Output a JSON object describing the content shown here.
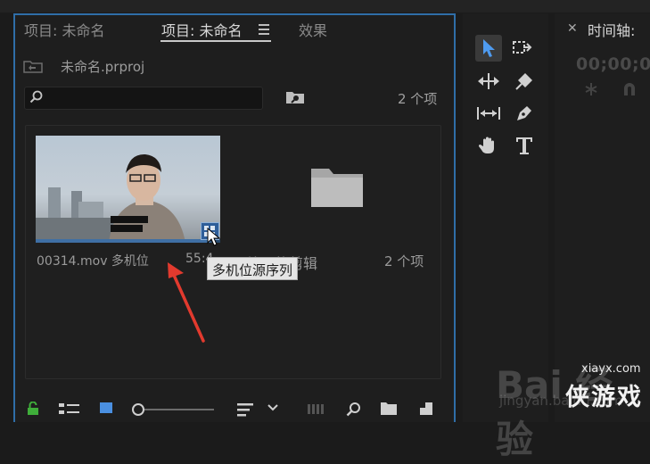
{
  "project_panel": {
    "tabs": [
      {
        "label": "项目: 未命名",
        "active": false
      },
      {
        "label": "项目: 未命名",
        "active": true
      },
      {
        "label": "效果",
        "active": false
      }
    ],
    "project_file": "未命名.prproj",
    "search": {
      "placeholder": "",
      "value": ""
    },
    "item_count": "2 个项",
    "items": [
      {
        "type": "multicam-clip",
        "name": "00314.mov 多机位",
        "duration": "55:4"
      },
      {
        "type": "bin",
        "name": "处理的剪辑",
        "count": "2 个项"
      }
    ],
    "tooltip": "多机位源序列",
    "accent_color": "#2f6ea8",
    "bottom_toolbar_icons": [
      "lock-icon",
      "list-view-icon",
      "icon-view-icon",
      "zoom-slider",
      "sort-icon",
      "chevron-down-icon",
      "automate-to-sequence-icon",
      "find-icon",
      "new-bin-icon",
      "new-item-icon"
    ]
  },
  "tools": [
    "selection-tool",
    "track-select-forward-tool",
    "ripple-edit-tool",
    "razor-tool",
    "slip-tool",
    "pen-tool",
    "hand-tool",
    "type-tool"
  ],
  "timeline": {
    "title": "时间轴:",
    "timecode": "00;00;00"
  },
  "watermark": {
    "url": "xiayx.com",
    "brand": "侠游戏",
    "faint": "Bai 经验",
    "faint_sub": "jingyan.baidu.com"
  }
}
